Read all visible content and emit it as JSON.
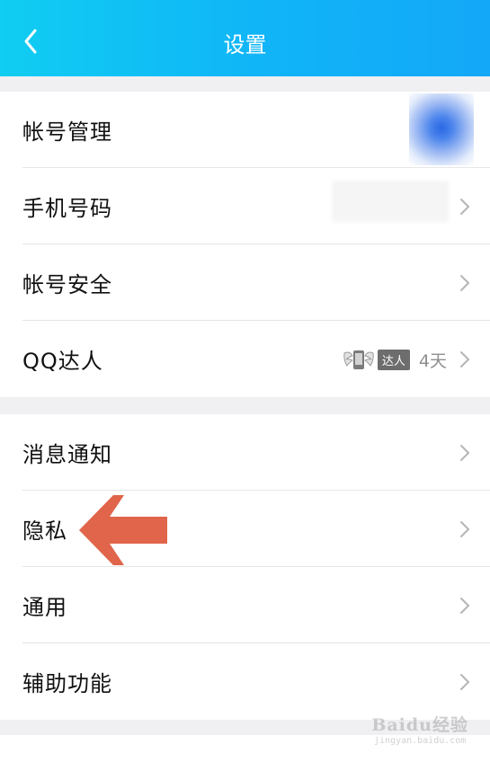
{
  "header": {
    "title": "设置"
  },
  "group1": {
    "items": [
      {
        "label": "帐号管理"
      },
      {
        "label": "手机号码"
      },
      {
        "label": "帐号安全"
      },
      {
        "label": "QQ达人",
        "badge": "达人",
        "days": "4天"
      }
    ]
  },
  "group2": {
    "items": [
      {
        "label": "消息通知"
      },
      {
        "label": "隐私"
      },
      {
        "label": "通用"
      },
      {
        "label": "辅助功能"
      }
    ]
  },
  "watermark": {
    "brand": "Baidu经验",
    "url": "jingyan.baidu.com"
  },
  "colors": {
    "header": "#12b8f6",
    "arrow": "#e0654a",
    "chevron": "#b5b5b5"
  }
}
